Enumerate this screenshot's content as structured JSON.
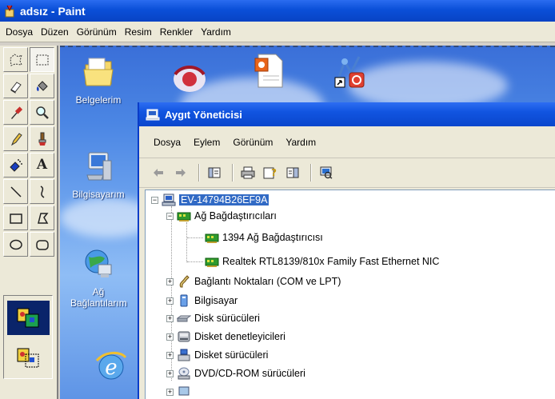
{
  "paint": {
    "title": "adsız - Paint",
    "menu": [
      "Dosya",
      "Düzen",
      "Görünüm",
      "Resim",
      "Renkler",
      "Yardım"
    ]
  },
  "toolbox": {
    "tools": [
      "free-form-select-icon",
      "rectangle-select-icon",
      "eraser-icon",
      "fill-bucket-icon",
      "color-picker-icon",
      "magnifier-icon",
      "pencil-icon",
      "brush-icon",
      "airbrush-icon",
      "text-icon",
      "line-icon",
      "curve-icon",
      "rectangle-icon",
      "polygon-icon",
      "ellipse-icon",
      "rounded-rectangle-icon"
    ],
    "text_tool_glyph": "A"
  },
  "desktop": {
    "icons": [
      {
        "label": "Belgelerim"
      },
      {
        "label": "Bilgisayarım"
      },
      {
        "label": "Ağ Bağlantılarım"
      }
    ]
  },
  "device_manager": {
    "title": "Aygıt Yöneticisi",
    "menu": [
      "Dosya",
      "Eylem",
      "Görünüm",
      "Yardım"
    ],
    "toolbar": [
      "back-icon",
      "forward-icon",
      "properties-view-icon",
      "print-icon",
      "help-icon",
      "console-tree-icon",
      "scan-hardware-icon"
    ],
    "tree": {
      "root": "EV-14794B26EF9A",
      "category_network": "Ağ Bağdaştırıcıları",
      "network_children": [
        "1394 Ağ Bağdaştırıcısı",
        "Realtek RTL8139/810x Family Fast Ethernet NIC"
      ],
      "categories": [
        "Bağlantı Noktaları (COM ve LPT)",
        "Bilgisayar",
        "Disk sürücüleri",
        "Disket denetleyicileri",
        "Disket sürücüleri",
        "DVD/CD-ROM sürücüleri"
      ]
    }
  },
  "colors": {
    "xp_blue": "#0a4fd8",
    "selection": "#316ac5",
    "network_green": "#2e9a2e"
  }
}
